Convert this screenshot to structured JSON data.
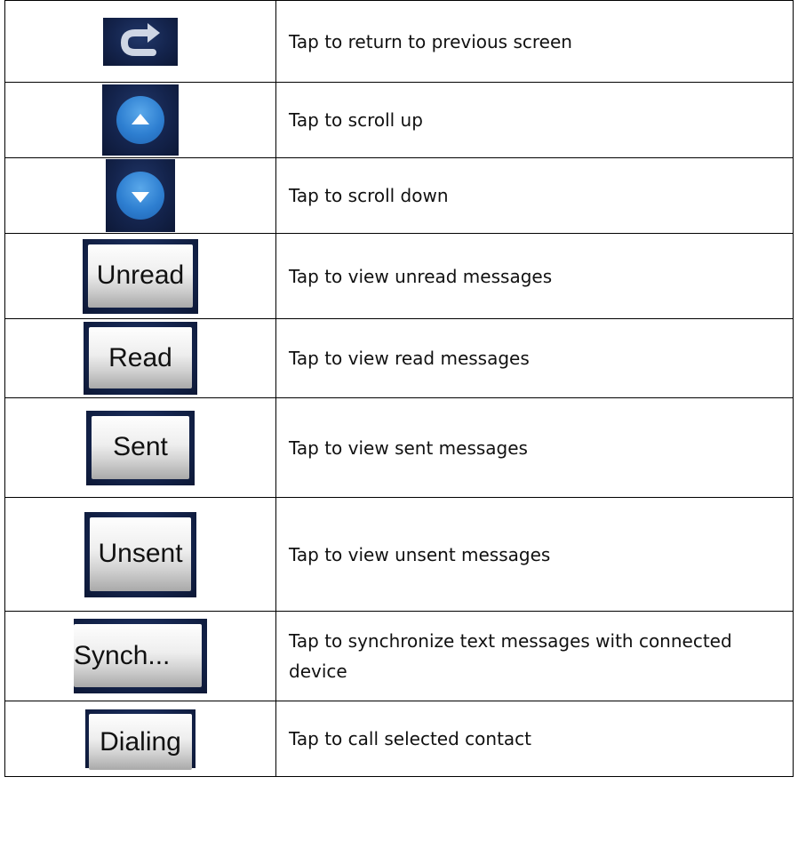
{
  "rows": [
    {
      "icon": "return-arrow-icon",
      "label": "",
      "description": "Tap to return to previous screen"
    },
    {
      "icon": "scroll-up-icon",
      "label": "",
      "description": "Tap to scroll up"
    },
    {
      "icon": "scroll-down-icon",
      "label": "",
      "description": "Tap to scroll down"
    },
    {
      "icon": "button",
      "label": "Unread",
      "description": "Tap to view unread messages"
    },
    {
      "icon": "button",
      "label": "Read",
      "description": "Tap to view read messages"
    },
    {
      "icon": "button",
      "label": "Sent",
      "description": "Tap to view sent messages"
    },
    {
      "icon": "button",
      "label": "Unsent",
      "description": "Tap to view unsent messages"
    },
    {
      "icon": "button",
      "label": "Synch...",
      "description": "Tap to synchronize text messages with connected device"
    },
    {
      "icon": "button",
      "label": "Dialing",
      "description": "Tap to call selected contact"
    }
  ],
  "colors": {
    "frame": "#14244d",
    "circle": "#2e7fd1",
    "border": "#000000"
  }
}
